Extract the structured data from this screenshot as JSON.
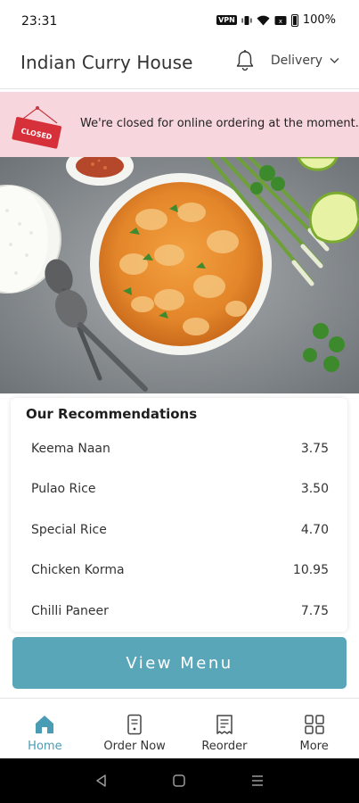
{
  "status_bar": {
    "time": "23:31",
    "vpn": "VPN",
    "battery": "100%"
  },
  "header": {
    "title": "Indian Curry House",
    "delivery_label": "Delivery"
  },
  "banner": {
    "sign_text": "CLOSED",
    "message": "We're closed for online ordering at the moment."
  },
  "recommendations": {
    "title": "Our Recommendations",
    "items": [
      {
        "name": "Keema Naan",
        "price": "3.75"
      },
      {
        "name": "Pulao Rice",
        "price": "3.50"
      },
      {
        "name": "Special Rice",
        "price": "4.70"
      },
      {
        "name": "Chicken Korma",
        "price": "10.95"
      },
      {
        "name": "Chilli Paneer",
        "price": "7.75"
      }
    ]
  },
  "view_menu_label": "View Menu",
  "bottom_nav": [
    {
      "label": "Home",
      "icon": "home-icon",
      "active": true
    },
    {
      "label": "Order Now",
      "icon": "order-icon",
      "active": false
    },
    {
      "label": "Reorder",
      "icon": "receipt-icon",
      "active": false
    },
    {
      "label": "More",
      "icon": "grid-icon",
      "active": false
    }
  ],
  "colors": {
    "accent": "#5aa6b9",
    "banner_bg": "#f8d6dd",
    "closed_sign": "#d6303b",
    "nav_active": "#4a9cb4"
  }
}
